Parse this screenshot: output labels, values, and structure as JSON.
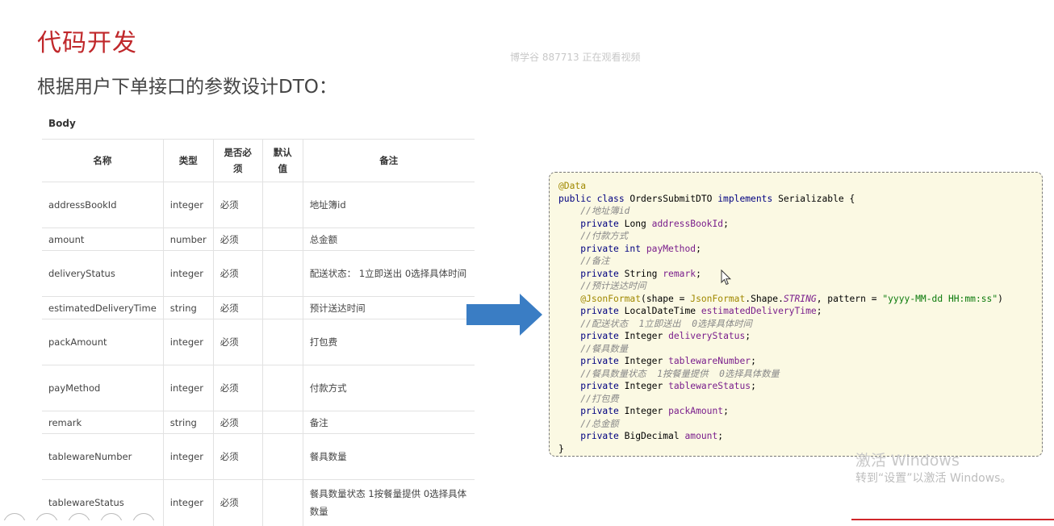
{
  "slide": {
    "title": "代码开发",
    "subtitle": "根据用户下单接口的参数设计DTO：",
    "viewer_watermark": "博学谷 887713 正在观看视频"
  },
  "table": {
    "section_label": "Body",
    "headers": [
      "名称",
      "类型",
      "是否必须",
      "默认值",
      "备注"
    ],
    "rows": [
      {
        "name": "addressBookId",
        "type": "integer",
        "required": "必须",
        "default": "",
        "note": "地址簿id"
      },
      {
        "name": "amount",
        "type": "number",
        "required": "必须",
        "default": "",
        "note": "总金额"
      },
      {
        "name": "deliveryStatus",
        "type": "integer",
        "required": "必须",
        "default": "",
        "note": "配送状态：  1立即送出  0选择具体时间"
      },
      {
        "name": "estimatedDeliveryTime",
        "type": "string",
        "required": "必须",
        "default": "",
        "note": "预计送达时间"
      },
      {
        "name": "packAmount",
        "type": "integer",
        "required": "必须",
        "default": "",
        "note": "打包费"
      },
      {
        "name": "payMethod",
        "type": "integer",
        "required": "必须",
        "default": "",
        "note": "付款方式"
      },
      {
        "name": "remark",
        "type": "string",
        "required": "必须",
        "default": "",
        "note": "备注"
      },
      {
        "name": "tablewareNumber",
        "type": "integer",
        "required": "必须",
        "default": "",
        "note": "餐具数量"
      },
      {
        "name": "tablewareStatus",
        "type": "integer",
        "required": "必须",
        "default": "",
        "note": "餐具数量状态  1按餐量提供  0选择具体数量"
      }
    ]
  },
  "code": {
    "lines": [
      [
        [
          "ann",
          "@Data"
        ]
      ],
      [
        [
          "kw",
          "public class "
        ],
        [
          "",
          "OrdersSubmitDTO "
        ],
        [
          "kw",
          "implements "
        ],
        [
          "",
          "Serializable {"
        ]
      ],
      [
        [
          "",
          "    "
        ],
        [
          "cm",
          "//地址簿id"
        ]
      ],
      [
        [
          "",
          "    "
        ],
        [
          "kw",
          "private "
        ],
        [
          "",
          "Long "
        ],
        [
          "fld",
          "addressBookId"
        ],
        [
          "",
          ";"
        ]
      ],
      [
        [
          "",
          "    "
        ],
        [
          "cm",
          "//付款方式"
        ]
      ],
      [
        [
          "",
          "    "
        ],
        [
          "kw",
          "private int "
        ],
        [
          "fld",
          "payMethod"
        ],
        [
          "",
          ";"
        ]
      ],
      [
        [
          "",
          "    "
        ],
        [
          "cm",
          "//备注"
        ]
      ],
      [
        [
          "",
          "    "
        ],
        [
          "kw",
          "private "
        ],
        [
          "",
          "String "
        ],
        [
          "fld",
          "remark"
        ],
        [
          "",
          ";"
        ]
      ],
      [
        [
          "",
          "    "
        ],
        [
          "cm",
          "//预计送达时间"
        ]
      ],
      [
        [
          "",
          "    "
        ],
        [
          "ann",
          "@JsonFormat"
        ],
        [
          "",
          "(shape = "
        ],
        [
          "ann",
          "JsonFormat"
        ],
        [
          "",
          ".Shape."
        ],
        [
          "cst",
          "STRING"
        ],
        [
          "",
          ", pattern = "
        ],
        [
          "str",
          "\"yyyy-MM-dd HH:mm:ss\""
        ],
        [
          "",
          ")"
        ]
      ],
      [
        [
          "",
          "    "
        ],
        [
          "kw",
          "private "
        ],
        [
          "",
          "LocalDateTime "
        ],
        [
          "fld",
          "estimatedDeliveryTime"
        ],
        [
          "",
          ";"
        ]
      ],
      [
        [
          "",
          "    "
        ],
        [
          "cm",
          "//配送状态  1立即送出  0选择具体时间"
        ]
      ],
      [
        [
          "",
          "    "
        ],
        [
          "kw",
          "private "
        ],
        [
          "",
          "Integer "
        ],
        [
          "fld",
          "deliveryStatus"
        ],
        [
          "",
          ";"
        ]
      ],
      [
        [
          "",
          "    "
        ],
        [
          "cm",
          "//餐具数量"
        ]
      ],
      [
        [
          "",
          "    "
        ],
        [
          "kw",
          "private "
        ],
        [
          "",
          "Integer "
        ],
        [
          "fld",
          "tablewareNumber"
        ],
        [
          "",
          ";"
        ]
      ],
      [
        [
          "",
          "    "
        ],
        [
          "cm",
          "//餐具数量状态  1按餐量提供  0选择具体数量"
        ]
      ],
      [
        [
          "",
          "    "
        ],
        [
          "kw",
          "private "
        ],
        [
          "",
          "Integer "
        ],
        [
          "fld",
          "tablewareStatus"
        ],
        [
          "",
          ";"
        ]
      ],
      [
        [
          "",
          "    "
        ],
        [
          "cm",
          "//打包费"
        ]
      ],
      [
        [
          "",
          "    "
        ],
        [
          "kw",
          "private "
        ],
        [
          "",
          "Integer "
        ],
        [
          "fld",
          "packAmount"
        ],
        [
          "",
          ";"
        ]
      ],
      [
        [
          "",
          "    "
        ],
        [
          "cm",
          "//总金额"
        ]
      ],
      [
        [
          "",
          "    "
        ],
        [
          "kw",
          "private "
        ],
        [
          "",
          "BigDecimal "
        ],
        [
          "fld",
          "amount"
        ],
        [
          "",
          ";"
        ]
      ],
      [
        [
          "",
          "}"
        ]
      ]
    ]
  },
  "os_watermark": {
    "line1": "激活 Windows",
    "line2": "转到“设置”以激活 Windows。"
  },
  "colors": {
    "title": "#c0282b",
    "arrow": "#3a7dc4",
    "code_bg": "#fbf9e3"
  }
}
